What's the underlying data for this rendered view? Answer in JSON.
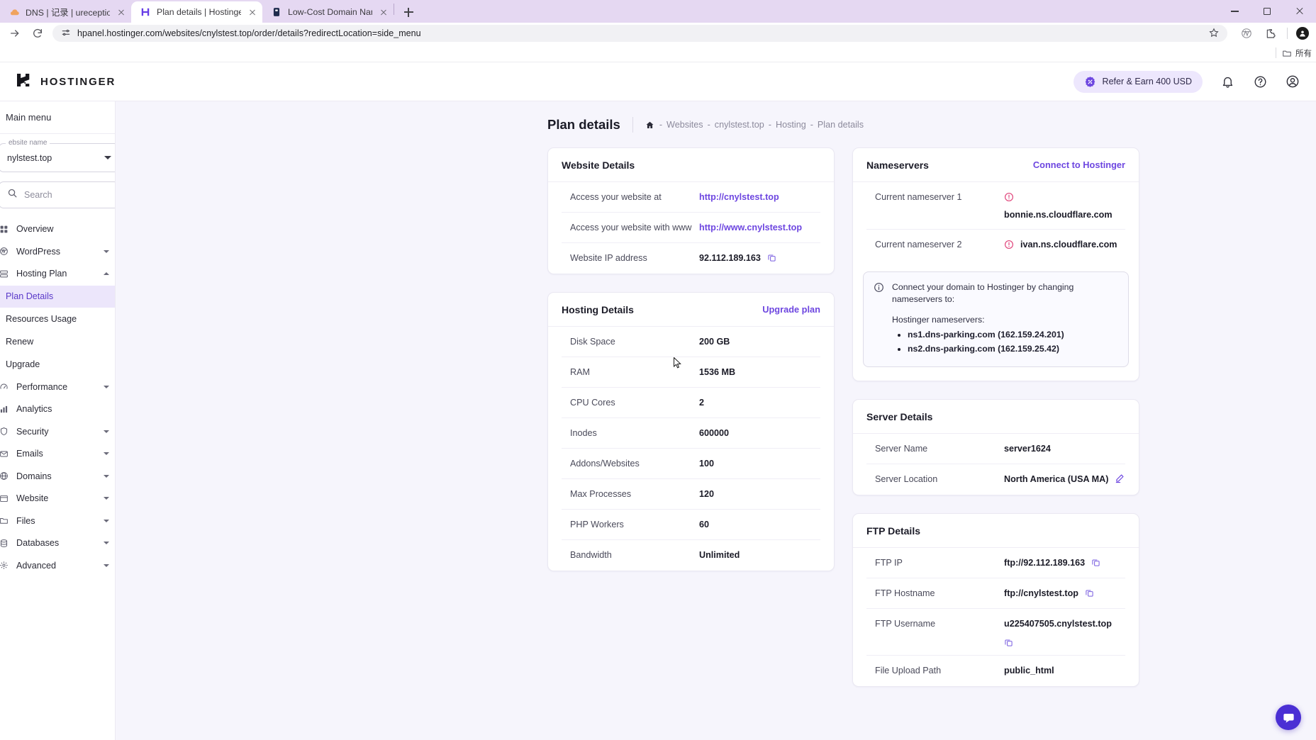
{
  "browser": {
    "tabs": [
      {
        "title": "DNS | 记录 | ureceptiondesk.c",
        "favicon": "cloud-icon",
        "active": false
      },
      {
        "title": "Plan details | Hostinger",
        "favicon": "hostinger-icon",
        "active": true
      },
      {
        "title": "Low-Cost Domain Names &",
        "favicon": "domain-icon",
        "active": false
      }
    ],
    "new_tab_label": "+",
    "url": "hpanel.hostinger.com/websites/cnylstest.top/order/details?redirectLocation=side_menu",
    "bookmark_folder": "所有",
    "window_controls": {
      "minimize": "–",
      "maximize": "▢",
      "close": "✕"
    }
  },
  "header": {
    "logo_text": "HOSTINGER",
    "refer_label": "Refer & Earn 400 USD",
    "icons": [
      "bell-icon",
      "help-icon",
      "account-icon"
    ]
  },
  "sidebar": {
    "main_menu": "Main menu",
    "website_select": {
      "label": "ebsite name",
      "value": "nylstest.top"
    },
    "search_placeholder": "Search",
    "items": [
      {
        "label": "Overview",
        "expandable": false
      },
      {
        "label": "WordPress",
        "expandable": true,
        "expanded": false
      },
      {
        "label": "Hosting Plan",
        "expandable": true,
        "expanded": true
      },
      {
        "label": "Performance",
        "expandable": true,
        "expanded": false
      },
      {
        "label": "Analytics",
        "expandable": false
      },
      {
        "label": "Security",
        "expandable": true,
        "expanded": false
      },
      {
        "label": "Emails",
        "expandable": true,
        "expanded": false
      },
      {
        "label": "Domains",
        "expandable": true,
        "expanded": false
      },
      {
        "label": "Website",
        "expandable": true,
        "expanded": false
      },
      {
        "label": "Files",
        "expandable": true,
        "expanded": false
      },
      {
        "label": "Databases",
        "expandable": true,
        "expanded": false
      },
      {
        "label": "Advanced",
        "expandable": true,
        "expanded": false
      }
    ],
    "hosting_plan_sub": [
      {
        "label": "Plan Details",
        "active": true
      },
      {
        "label": "Resources Usage",
        "active": false
      },
      {
        "label": "Renew",
        "active": false
      },
      {
        "label": "Upgrade",
        "active": false
      }
    ]
  },
  "page": {
    "title": "Plan details",
    "breadcrumb": [
      "Websites",
      "cnylstest.top",
      "Hosting",
      "Plan details"
    ],
    "breadcrumb_sep": "-"
  },
  "website_details": {
    "title": "Website Details",
    "rows": [
      {
        "label": "Access your website at",
        "value": "http://cnylstest.top",
        "kind": "link"
      },
      {
        "label": "Access your website with www",
        "value": "http://www.cnylstest.top",
        "kind": "link"
      },
      {
        "label": "Website IP address",
        "value": "92.112.189.163",
        "kind": "copy"
      }
    ]
  },
  "hosting_details": {
    "title": "Hosting Details",
    "action": "Upgrade plan",
    "rows": [
      {
        "label": "Disk Space",
        "value": "200 GB"
      },
      {
        "label": "RAM",
        "value": "1536 MB"
      },
      {
        "label": "CPU Cores",
        "value": "2"
      },
      {
        "label": "Inodes",
        "value": "600000"
      },
      {
        "label": "Addons/Websites",
        "value": "100"
      },
      {
        "label": "Max Processes",
        "value": "120"
      },
      {
        "label": "PHP Workers",
        "value": "60"
      },
      {
        "label": "Bandwidth",
        "value": "Unlimited"
      }
    ]
  },
  "nameservers": {
    "title": "Nameservers",
    "action": "Connect to Hostinger",
    "rows": [
      {
        "label": "Current nameserver 1",
        "value": "bonnie.ns.cloudflare.com",
        "warning": true
      },
      {
        "label": "Current nameserver 2",
        "value": "ivan.ns.cloudflare.com",
        "warning": true
      }
    ],
    "notice": {
      "headline": "Connect your domain to Hostinger by changing nameservers to:",
      "subhead": "Hostinger nameservers:",
      "items": [
        "ns1.dns-parking.com (162.159.24.201)",
        "ns2.dns-parking.com (162.159.25.42)"
      ]
    }
  },
  "server_details": {
    "title": "Server Details",
    "rows": [
      {
        "label": "Server Name",
        "value": "server1624"
      },
      {
        "label": "Server Location",
        "value": "North America (USA MA)",
        "editable": true
      }
    ]
  },
  "ftp_details": {
    "title": "FTP Details",
    "rows": [
      {
        "label": "FTP IP",
        "value": "ftp://92.112.189.163",
        "copy": true
      },
      {
        "label": "FTP Hostname",
        "value": "ftp://cnylstest.top",
        "copy": true
      },
      {
        "label": "FTP Username",
        "value": "u225407505.cnylstest.top",
        "copy": true
      },
      {
        "label": "File Upload Path",
        "value": "public_html",
        "copy": false
      }
    ]
  },
  "colors": {
    "accent": "#6d46e0",
    "tabstrip": "#e5d8f2",
    "page_bg": "#f6f5fc",
    "warning": "#e0457b",
    "chat": "#4a2fd4"
  }
}
